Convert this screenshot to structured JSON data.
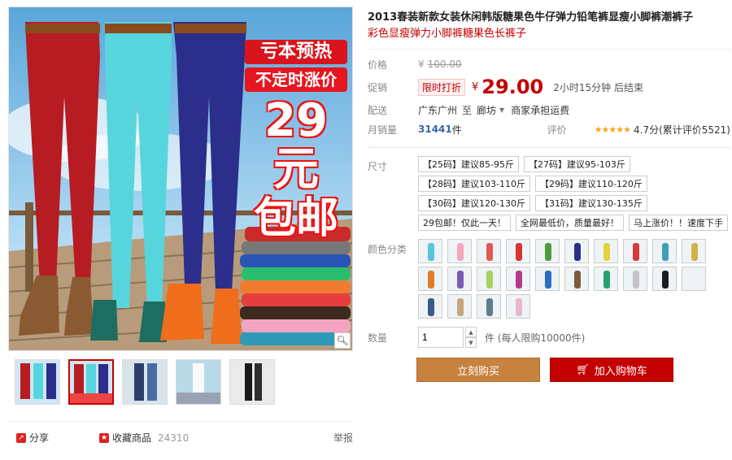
{
  "gallery": {
    "promo_line1": "亏本预热",
    "promo_line2": "不定时涨价",
    "promo_price": "29元",
    "promo_shipping": "包邮",
    "zoom_icon": "magnifier-icon",
    "thumbnails": [
      {
        "colors": [
          "#b71c22",
          "#56d6dc",
          "#2b2e8a"
        ]
      },
      {
        "colors": [
          "#b71c22",
          "#56d6dc",
          "#2b2e8a"
        ]
      },
      {
        "colors": [
          "#2d3e6e",
          "#6b8fc3",
          "#3a3a3a"
        ]
      },
      {
        "colors": [
          "#ffffff",
          "#d1d1d1",
          "#9aa3b5"
        ]
      },
      {
        "colors": [
          "#1a1a1a",
          "#2e2e2e",
          "#555555"
        ]
      }
    ],
    "share_label": "分享",
    "favorite_label": "收藏商品",
    "favorite_count": "24310",
    "report_label": "举报"
  },
  "product": {
    "title": "2013春装新款女装休闲韩版糖果色牛仔弹力铅笔裤显瘦小脚裤潮裤子",
    "subtitle": "彩色显瘦弹力小脚裤糖果色长裤子",
    "price_label": "价格",
    "original_price_currency": "¥",
    "original_price": "100.00",
    "promo_label": "促销",
    "promo_tag": "限时打折",
    "currency": "¥",
    "price": "29.00",
    "countdown": "2小时15分钟 后结束",
    "delivery_label": "配送",
    "delivery_from": "广东广州",
    "delivery_to_word": "至",
    "delivery_to": "廊坊",
    "delivery_fee": "商家承担运费",
    "monthly_sales_label": "月销量",
    "monthly_sales": "31441",
    "monthly_sales_unit": "件",
    "rating_label": "评价",
    "rating_text": "4.7分(累计评价5521)"
  },
  "options": {
    "size_label": "尺寸",
    "sizes": [
      "【25码】建议85-95斤",
      "【27码】建议95-103斤",
      "【28码】建议103-110斤",
      "【29码】建议110-120斤",
      "【30码】建议120-130斤",
      "【31码】建议130-135斤",
      "29包邮！仅此一天！",
      "全网最低价，质量最好！",
      "马上涨价！！速度下手"
    ],
    "color_label": "颜色分类",
    "color_swatches": [
      "#56c7d8",
      "#f4a8c0",
      "#e05a4f",
      "#d93434",
      "#4e9a3a",
      "#2d2d8c",
      "#e6d23c",
      "#d33b3b",
      "#3f9fb5",
      "#d2b24a",
      "#e07a2c",
      "#7b5bb5",
      "#a9cf5f",
      "#b53a8c",
      "#2c6cc4",
      "#7e5a3a",
      "#28a06a",
      "#c4c4c4",
      "#1c1c1c",
      "#f2f2f2",
      "#3a5a8a",
      "#c6a67a",
      "#607d8b",
      "#e8b8c8"
    ],
    "quantity_label": "数量",
    "quantity_value": "1",
    "quantity_hint": "件 (每人限购10000件)"
  },
  "actions": {
    "buy_now": "立刻购买",
    "add_to_cart": "加入购物车"
  }
}
